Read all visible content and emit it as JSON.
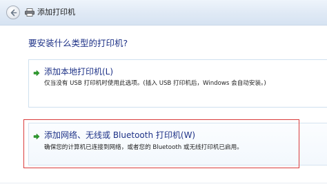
{
  "window": {
    "title": "添加打印机"
  },
  "main": {
    "question": "要安装什么类型的打印机?",
    "options": [
      {
        "title": "添加本地打印机(L)",
        "description": "仅当没有 USB 打印机时使用此选项。(插入 USB 打印机后，Windows 会自动安装。)",
        "icon": "green-arrow-icon"
      },
      {
        "title": "添加网络、无线或 Bluetooth 打印机(W)",
        "description": "确保您的计算机已连接到网络，或者您的 Bluetooth 或无线打印机已启用。",
        "icon": "green-arrow-icon"
      }
    ]
  },
  "colors": {
    "heading_blue": "#1e3287",
    "arrow_green": "#2e9b2e",
    "highlight_red": "#d93a3a"
  }
}
